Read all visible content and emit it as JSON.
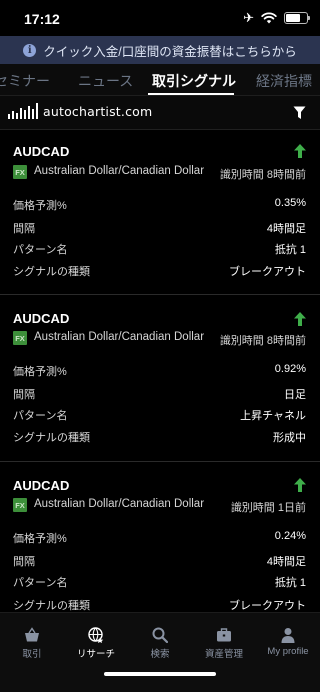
{
  "status_bar": {
    "time": "17:12"
  },
  "banner": {
    "icon": "info-icon",
    "text": "クイック入金/口座間の資金振替はこちらから"
  },
  "tabs": [
    {
      "label": "セミナー",
      "active": false
    },
    {
      "label": "ニュース",
      "active": false
    },
    {
      "label": "取引シグナル",
      "active": true
    },
    {
      "label": "経済指標",
      "active": false
    }
  ],
  "provider": {
    "logo_text": "autochartist.com",
    "filter_icon": "filter-icon"
  },
  "signals": [
    {
      "symbol": "AUDCAD",
      "badge": "FX",
      "pair_name": "Australian Dollar/Canadian Dollar",
      "detected": "識別時間 8時間前",
      "direction": "up",
      "rows": [
        {
          "label": "価格予測%",
          "value": "0.35%"
        },
        {
          "label": "間隔",
          "value": "4時間足"
        },
        {
          "label": "パターン名",
          "value": "抵抗 1"
        },
        {
          "label": "シグナルの種類",
          "value": "ブレークアウト"
        }
      ]
    },
    {
      "symbol": "AUDCAD",
      "badge": "FX",
      "pair_name": "Australian Dollar/Canadian Dollar",
      "detected": "識別時間 8時間前",
      "direction": "up",
      "rows": [
        {
          "label": "価格予測%",
          "value": "0.92%"
        },
        {
          "label": "間隔",
          "value": "日足"
        },
        {
          "label": "パターン名",
          "value": "上昇チャネル"
        },
        {
          "label": "シグナルの種類",
          "value": "形成中"
        }
      ]
    },
    {
      "symbol": "AUDCAD",
      "badge": "FX",
      "pair_name": "Australian Dollar/Canadian Dollar",
      "detected": "識別時間 1日前",
      "direction": "up",
      "rows": [
        {
          "label": "価格予測%",
          "value": "0.24%"
        },
        {
          "label": "間隔",
          "value": "4時間足"
        },
        {
          "label": "パターン名",
          "value": "抵抗 1"
        },
        {
          "label": "シグナルの種類",
          "value": "ブレークアウト"
        }
      ]
    }
  ],
  "bottom_nav": [
    {
      "label": "取引",
      "icon": "basket-icon",
      "active": false
    },
    {
      "label": "リサーチ",
      "icon": "globe-icon",
      "active": true
    },
    {
      "label": "検索",
      "icon": "search-icon",
      "active": false
    },
    {
      "label": "資産管理",
      "icon": "briefcase-icon",
      "active": false
    },
    {
      "label": "My profile",
      "icon": "person-icon",
      "active": false
    }
  ],
  "colors": {
    "accent_green": "#3fae4a",
    "banner_bg": "#2b3450",
    "inactive": "#6b7585"
  }
}
